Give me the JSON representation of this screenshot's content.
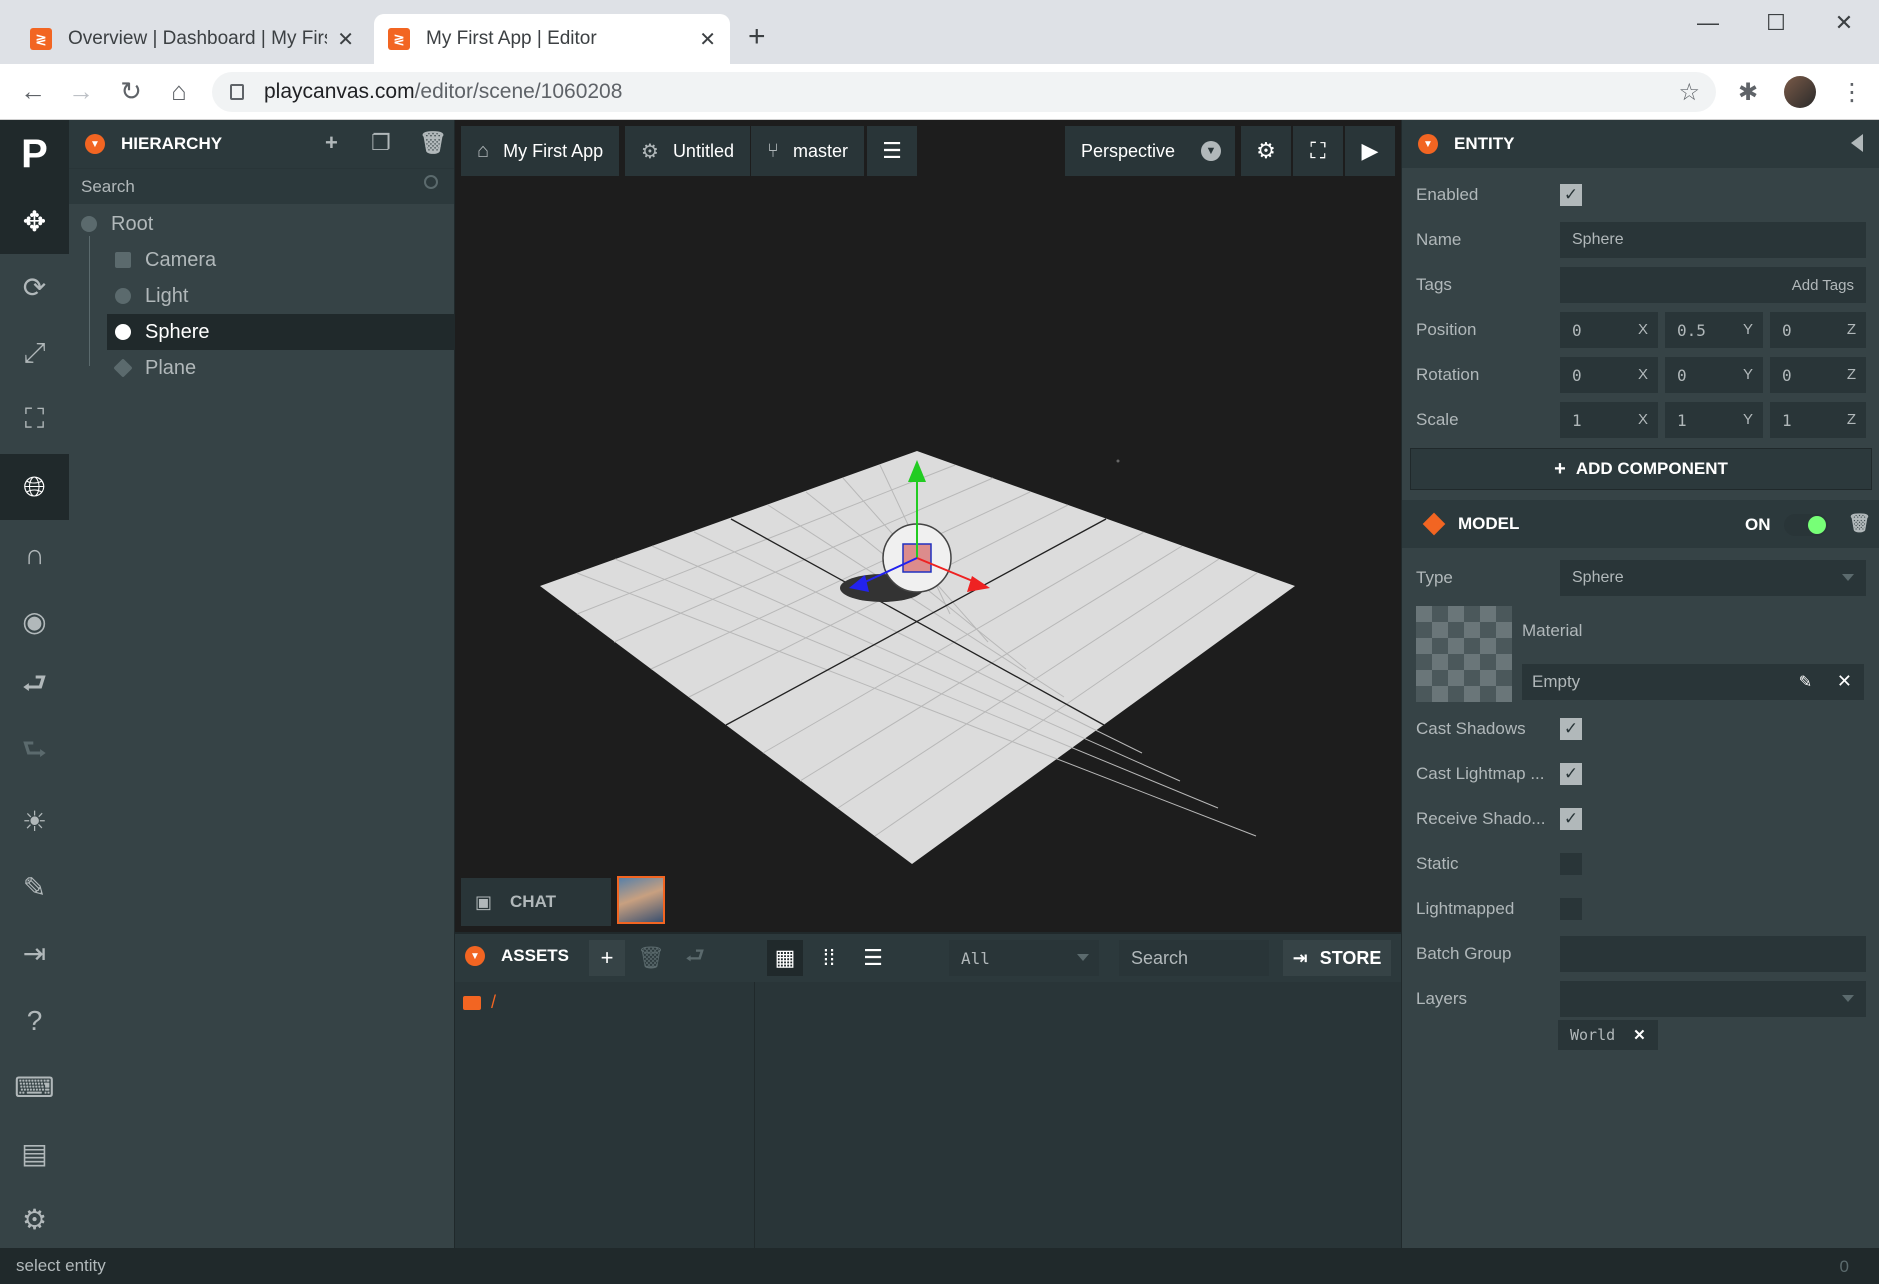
{
  "browser": {
    "tabs": [
      {
        "title": "Overview | Dashboard | My First App",
        "active": false
      },
      {
        "title": "My First App | Editor",
        "active": true
      }
    ],
    "url_domain": "playcanvas.com",
    "url_path": "/editor/scene/1060208"
  },
  "toolbar": {
    "logo": "P",
    "tools": [
      "move-icon",
      "rotate-icon",
      "scale-icon",
      "resize-icon",
      "world-icon",
      "snap-icon",
      "focus-icon",
      "undo-icon",
      "redo-icon",
      "bake-icon",
      "code-icon",
      "publish-icon",
      "help-icon",
      "keyboard-icon",
      "comments-icon",
      "settings-icon"
    ]
  },
  "hierarchy": {
    "title": "HIERARCHY",
    "search_placeholder": "Search",
    "items": [
      {
        "label": "Root",
        "depth": 0,
        "icon": "entity-icon"
      },
      {
        "label": "Camera",
        "depth": 1,
        "icon": "camera-icon"
      },
      {
        "label": "Light",
        "depth": 1,
        "icon": "light-icon"
      },
      {
        "label": "Sphere",
        "depth": 1,
        "icon": "entity-icon",
        "selected": true
      },
      {
        "label": "Plane",
        "depth": 1,
        "icon": "model-icon"
      }
    ]
  },
  "viewport": {
    "project": "My First App",
    "scene": "Untitled",
    "branch": "master",
    "camera": "Perspective",
    "chat_label": "CHAT"
  },
  "assets": {
    "title": "ASSETS",
    "filter": "All",
    "search_placeholder": "Search",
    "store_label": "STORE",
    "folder_path": "/"
  },
  "inspector": {
    "entity_title": "ENTITY",
    "enabled_label": "Enabled",
    "enabled": true,
    "name_label": "Name",
    "name": "Sphere",
    "tags_label": "Tags",
    "tags_placeholder": "Add Tags",
    "position_label": "Position",
    "position": [
      "0",
      "0.5",
      "0"
    ],
    "rotation_label": "Rotation",
    "rotation": [
      "0",
      "0",
      "0"
    ],
    "scale_label": "Scale",
    "scale": [
      "1",
      "1",
      "1"
    ],
    "axes": [
      "X",
      "Y",
      "Z"
    ],
    "add_component": "ADD COMPONENT",
    "model": {
      "title": "MODEL",
      "state": "ON",
      "type_label": "Type",
      "type": "Sphere",
      "material_label": "Material",
      "material": "Empty",
      "cast_shadows_label": "Cast Shadows",
      "cast_shadows": true,
      "cast_lightmap_label": "Cast Lightmap ...",
      "cast_lightmap": true,
      "receive_shadows_label": "Receive Shado...",
      "receive_shadows": true,
      "static_label": "Static",
      "static": false,
      "lightmapped_label": "Lightmapped",
      "lightmapped": false,
      "batch_group_label": "Batch Group",
      "batch_group": "",
      "layers_label": "Layers",
      "layers": [
        "World"
      ]
    }
  },
  "status": {
    "text": "select entity",
    "count": "0"
  },
  "colors": {
    "accent": "#f26522",
    "panel": "#364346",
    "panel_dark": "#293538",
    "text": "#b1b8ba"
  }
}
